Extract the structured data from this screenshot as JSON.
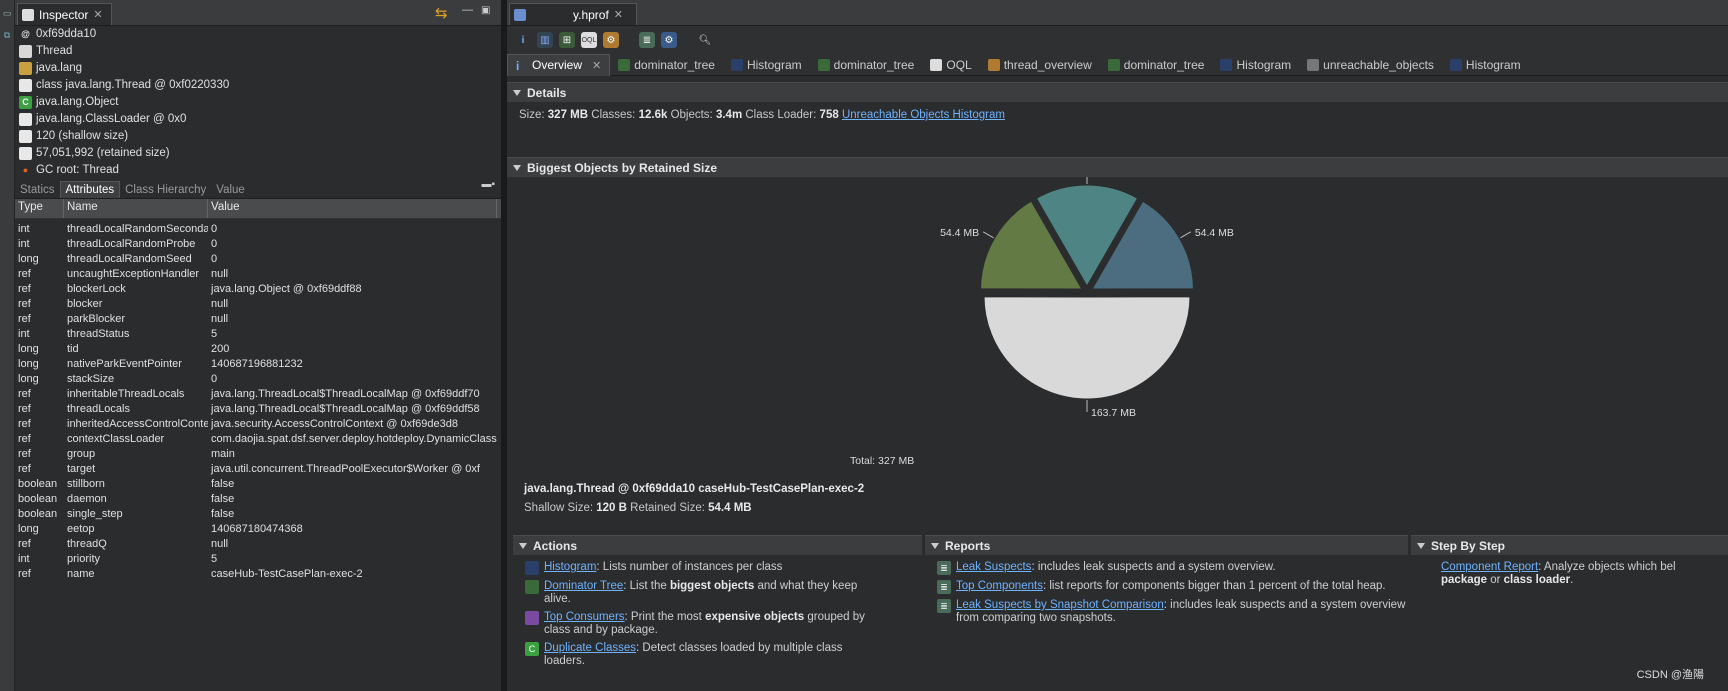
{
  "inspector": {
    "tab_label": "Inspector",
    "header_lines": [
      {
        "icon": "at-icon",
        "text": "0xf69dda10"
      },
      {
        "icon": "class-icon",
        "text": "Thread"
      },
      {
        "icon": "package-icon",
        "text": "java.lang"
      },
      {
        "icon": "class-file-icon",
        "text": "class java.lang.Thread @ 0xf0220330"
      },
      {
        "icon": "superclass-icon",
        "text": "java.lang.Object"
      },
      {
        "icon": "classloader-icon",
        "text": "java.lang.ClassLoader @ 0x0"
      },
      {
        "icon": "doc-icon",
        "text": "120 (shallow size)"
      },
      {
        "icon": "doc-icon",
        "text": "57,051,992 (retained size)"
      },
      {
        "icon": "gc-root-icon",
        "text": "GC root: Thread"
      }
    ],
    "attr_tabs": [
      "Statics",
      "Attributes",
      "Class Hierarchy",
      "Value"
    ],
    "attr_tab_active": "Attributes",
    "columns": [
      "Type",
      "Name",
      "Value"
    ],
    "rows": [
      [
        "int",
        "threadLocalRandomSecondarySeed",
        "0"
      ],
      [
        "int",
        "threadLocalRandomProbe",
        "0"
      ],
      [
        "long",
        "threadLocalRandomSeed",
        "0"
      ],
      [
        "ref",
        "uncaughtExceptionHandler",
        "null"
      ],
      [
        "ref",
        "blockerLock",
        "java.lang.Object @ 0xf69ddf88"
      ],
      [
        "ref",
        "blocker",
        "null"
      ],
      [
        "ref",
        "parkBlocker",
        "null"
      ],
      [
        "int",
        "threadStatus",
        "5"
      ],
      [
        "long",
        "tid",
        "200"
      ],
      [
        "long",
        "nativeParkEventPointer",
        "140687196881232"
      ],
      [
        "long",
        "stackSize",
        "0"
      ],
      [
        "ref",
        "inheritableThreadLocals",
        "java.lang.ThreadLocal$ThreadLocalMap @ 0xf69ddf70"
      ],
      [
        "ref",
        "threadLocals",
        "java.lang.ThreadLocal$ThreadLocalMap @ 0xf69ddf58"
      ],
      [
        "ref",
        "inheritedAccessControlContext",
        "java.security.AccessControlContext @ 0xf69de3d8"
      ],
      [
        "ref",
        "contextClassLoader",
        "com.daojia.spat.dsf.server.deploy.hotdeploy.DynamicClassLoader"
      ],
      [
        "ref",
        "group",
        "main"
      ],
      [
        "ref",
        "target",
        "java.util.concurrent.ThreadPoolExecutor$Worker @ 0xf"
      ],
      [
        "boolean",
        "stillborn",
        "false"
      ],
      [
        "boolean",
        "daemon",
        "false"
      ],
      [
        "boolean",
        "single_step",
        "false"
      ],
      [
        "long",
        "eetop",
        "140687180474368"
      ],
      [
        "ref",
        "threadQ",
        "null"
      ],
      [
        "int",
        "priority",
        "5"
      ],
      [
        "ref",
        "name",
        "caseHub-TestCasePlan-exec-2"
      ]
    ]
  },
  "editor": {
    "file_tab": "y.hprof",
    "sub_tabs": [
      {
        "label": "Overview",
        "icon": "info-icon",
        "active": true
      },
      {
        "label": "dominator_tree",
        "icon": "tree-icon"
      },
      {
        "label": "Histogram",
        "icon": "histogram-icon"
      },
      {
        "label": "dominator_tree",
        "icon": "tree-icon"
      },
      {
        "label": "OQL",
        "icon": "oql-icon"
      },
      {
        "label": "thread_overview",
        "icon": "threads-icon"
      },
      {
        "label": "dominator_tree",
        "icon": "tree-icon"
      },
      {
        "label": "Histogram",
        "icon": "histogram-icon"
      },
      {
        "label": "unreachable_objects",
        "icon": "bars-icon"
      },
      {
        "label": "Histogram",
        "icon": "histogram-icon"
      }
    ],
    "details": {
      "title": "Details",
      "size_label": "Size:",
      "size": "327 MB",
      "classes_label": "Classes:",
      "classes": "12.6k",
      "objects_label": "Objects:",
      "objects": "3.4m",
      "loader_label": "Class Loader:",
      "loader": "758",
      "link": "Unreachable Objects Histogram"
    },
    "biggest": {
      "title": "Biggest Objects by Retained Size",
      "total": "Total: 327 MB",
      "object_title": "java.lang.Thread @ 0xf69dda10 caseHub-TestCasePlan-exec-2",
      "shallow_label": "Shallow Size:",
      "shallow": "120 B",
      "retained_label": "Retained Size:",
      "retained": "54.4 MB"
    },
    "actions": {
      "title": "Actions",
      "items": [
        {
          "link": "Histogram",
          "pre": ": Lists number of instances per class",
          "bold": "",
          "post": ""
        },
        {
          "link": "Dominator Tree",
          "pre": ": List the ",
          "bold": "biggest objects",
          "post": " and what they keep alive."
        },
        {
          "link": "Top Consumers",
          "pre": ": Print the most ",
          "bold": "expensive objects",
          "post": " grouped by class and by package."
        },
        {
          "link": "Duplicate Classes",
          "pre": ": Detect classes loaded by multiple class loaders.",
          "bold": "",
          "post": ""
        }
      ]
    },
    "reports": {
      "title": "Reports",
      "items": [
        {
          "link": "Leak Suspects",
          "text": ": includes leak suspects and a system overview."
        },
        {
          "link": "Top Components",
          "text": ": list reports for components bigger than 1 percent of the total heap."
        },
        {
          "link": "Leak Suspects by Snapshot Comparison",
          "text": ": includes leak suspects and a system overview from comparing two snapshots."
        }
      ]
    },
    "step": {
      "title": "Step By Step",
      "link": "Component Report",
      "text": ": Analyze objects which bel",
      "bold1": "package",
      "or": " or ",
      "bold2": "class loader",
      "end": "."
    }
  },
  "chart_data": {
    "type": "pie",
    "total": "Total: 327 MB",
    "slices": [
      {
        "label": "163.7 MB",
        "value": 163.7,
        "color": "#d9d9d9"
      },
      {
        "label": "54.4 MB",
        "value": 54.4,
        "color": "#637a45"
      },
      {
        "label": "54.4 MB",
        "value": 54.4,
        "color": "#4e8584"
      },
      {
        "label": "54.4 MB",
        "value": 54.4,
        "color": "#4c6d80"
      }
    ]
  },
  "watermark": "CSDN @渔陽"
}
